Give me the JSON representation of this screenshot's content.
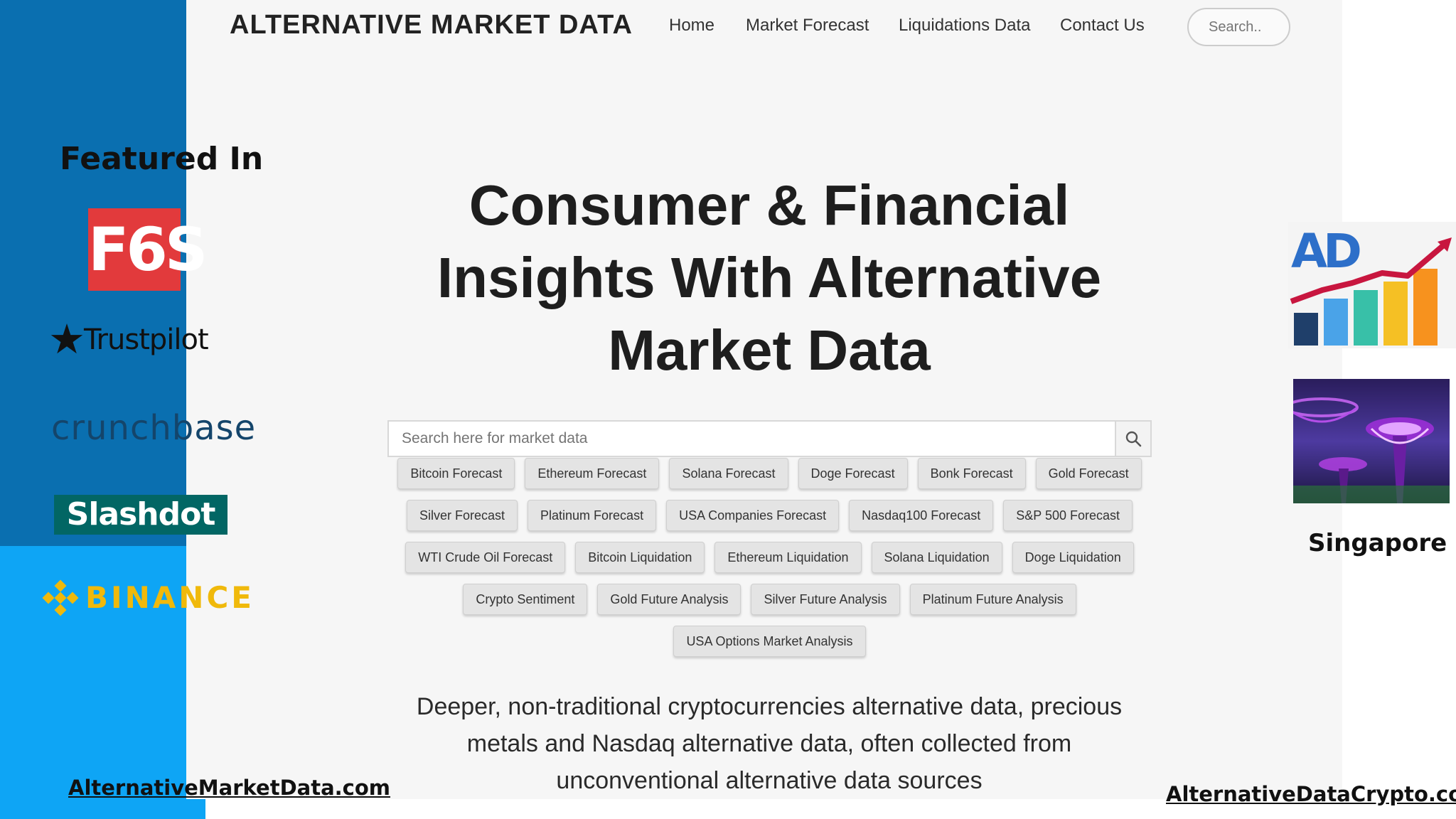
{
  "banner": {
    "featured_title": "Featured In",
    "logos": [
      "F6S",
      "Trustpilot",
      "crunchbase",
      "Slashdot",
      "BINANCE"
    ],
    "colors": {
      "dark_blue": "#0a6fb0",
      "light_blue": "#0ea5f5"
    }
  },
  "nav": {
    "brand": "ALTERNATIVE MARKET DATA",
    "links": [
      "Home",
      "Market Forecast",
      "Liquidations Data",
      "Contact Us"
    ],
    "search_placeholder": "Search.."
  },
  "hero": {
    "title": "Consumer & Financial Insights With Alternative Market Data",
    "search_placeholder": "Search here for market data",
    "search_icon": "search-icon",
    "chip_rows": [
      [
        "Bitcoin Forecast",
        "Ethereum Forecast",
        "Solana Forecast",
        "Doge Forecast",
        "Bonk Forecast",
        "Gold Forecast"
      ],
      [
        "Silver Forecast",
        "Platinum Forecast",
        "USA Companies Forecast",
        "Nasdaq100 Forecast",
        "S&P 500 Forecast"
      ],
      [
        "WTI Crude Oil Forecast",
        "Bitcoin Liquidation",
        "Ethereum Liquidation",
        "Solana Liquidation",
        "Doge Liquidation"
      ],
      [
        "Crypto Sentiment",
        "Gold Future Analysis",
        "Silver Future Analysis",
        "Platinum Future Analysis"
      ],
      [
        "USA Options Market Analysis"
      ]
    ],
    "subtitle": "Deeper, non-traditional cryptocurrencies alternative data, precious metals and Nasdaq alternative data, often collected from unconventional alternative data sources"
  },
  "right": {
    "logo_text": "AD",
    "photo_caption": "Singapore"
  },
  "footer": {
    "left_link": "AlternativeMarketData.com",
    "right_link": "AlternativeDataCrypto.com"
  }
}
